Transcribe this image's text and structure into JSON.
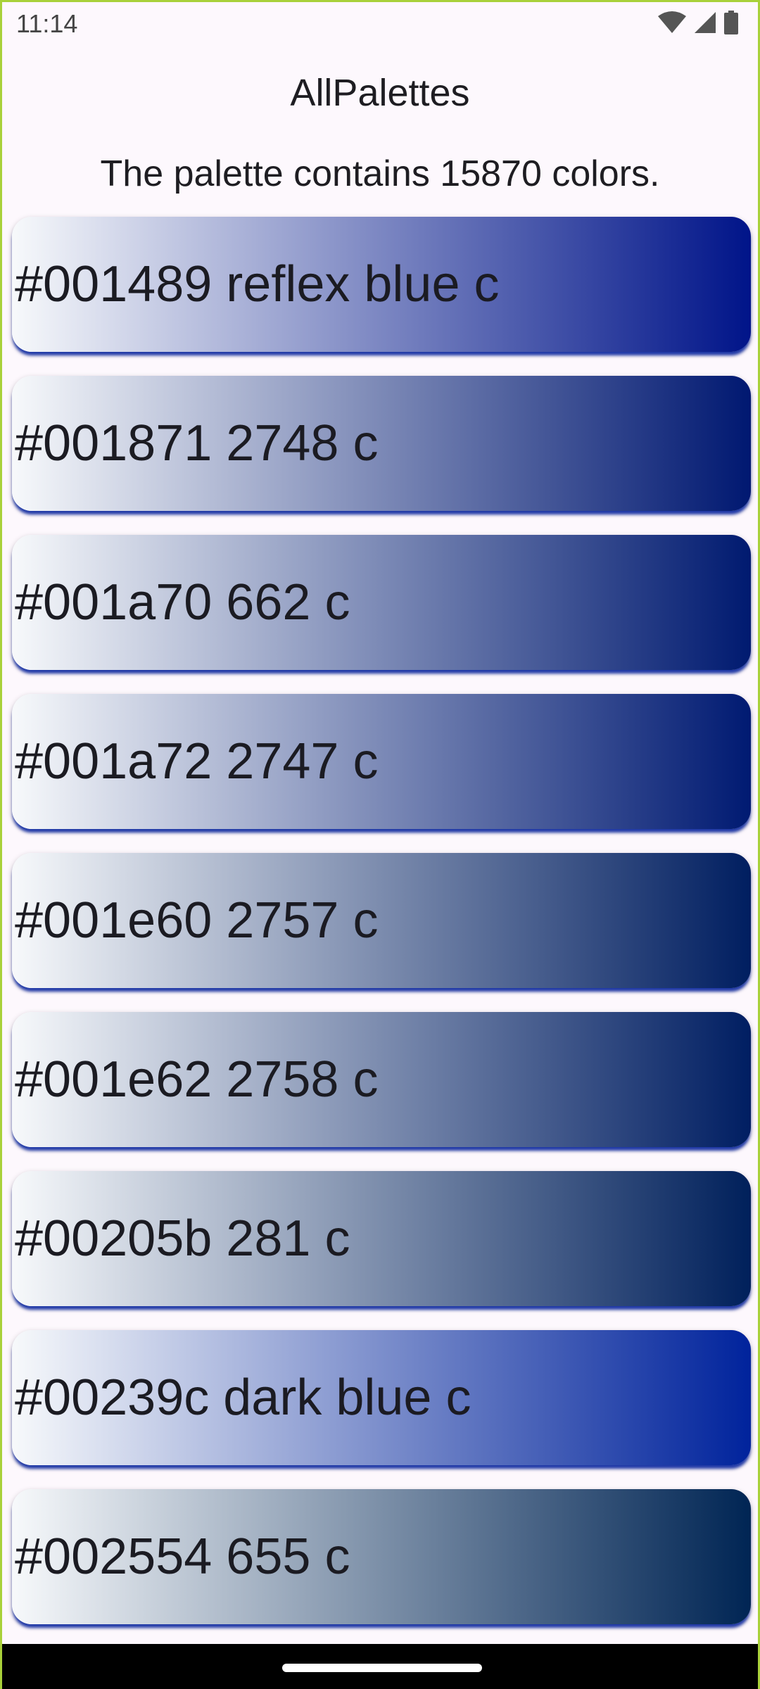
{
  "status_bar": {
    "time": "11:14",
    "icons": [
      "wifi-icon",
      "signal-icon",
      "battery-icon"
    ]
  },
  "app": {
    "title": "AllPalettes",
    "subtitle": "The palette contains 15870 colors."
  },
  "colors": [
    {
      "label": "#001489 reflex blue c",
      "hex": "#001489"
    },
    {
      "label": "#001871 2748 c",
      "hex": "#001871"
    },
    {
      "label": "#001a70 662 c",
      "hex": "#001a70"
    },
    {
      "label": "#001a72 2747 c",
      "hex": "#001a72"
    },
    {
      "label": "#001e60 2757 c",
      "hex": "#001e60"
    },
    {
      "label": "#001e62 2758 c",
      "hex": "#001e62"
    },
    {
      "label": "#00205b 281 c",
      "hex": "#00205b"
    },
    {
      "label": "#00239c dark blue c",
      "hex": "#00239c"
    },
    {
      "label": "#002554 655 c",
      "hex": "#002554"
    }
  ],
  "theme": {
    "gradient_start": "#f7f9fb",
    "background": "#fdf8fd",
    "accent_border": "#a9d13a"
  }
}
